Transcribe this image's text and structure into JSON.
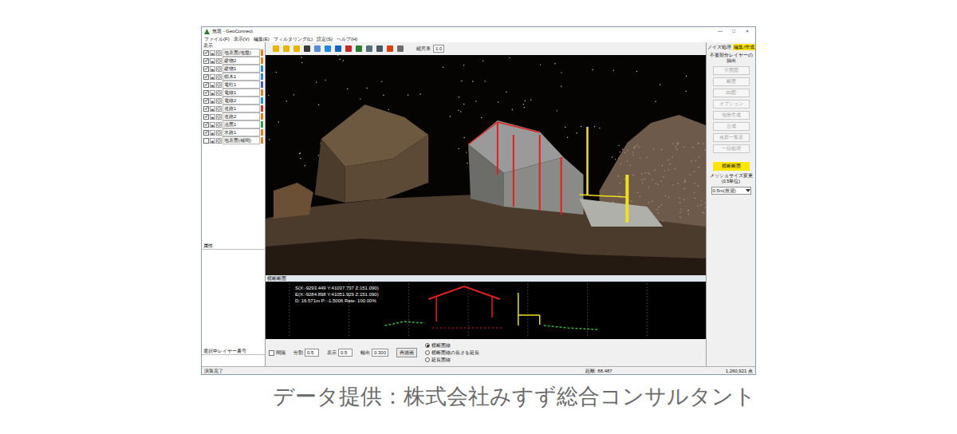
{
  "window": {
    "title": "無題 - GeoConnect",
    "controls": [
      "—",
      "□",
      "×"
    ]
  },
  "menu": [
    "ファイル(F)",
    "表示(V)",
    "編集(E)",
    "フィルタリング(L)",
    "設定(S)",
    "ヘルプ(H)"
  ],
  "layers_title": "表示",
  "layers": [
    {
      "name": "地表面(地盤)",
      "visible": true,
      "color": "#e67e22"
    },
    {
      "name": "建物2",
      "visible": true,
      "color": "#e67e22"
    },
    {
      "name": "建物1",
      "visible": true,
      "color": "#2e86de"
    },
    {
      "name": "樹木1",
      "visible": true,
      "color": "#2e86de"
    },
    {
      "name": "電柱1",
      "visible": true,
      "color": "#3b5bdb"
    },
    {
      "name": "電線1",
      "visible": true,
      "color": "#e67e22"
    },
    {
      "name": "電線2",
      "visible": true,
      "color": "#1e90ff"
    },
    {
      "name": "道路1",
      "visible": true,
      "color": "#e03131"
    },
    {
      "name": "道路2",
      "visible": true,
      "color": "#e67e22"
    },
    {
      "name": "法面1",
      "visible": true,
      "color": "#2f9e44"
    },
    {
      "name": "水路1",
      "visible": true,
      "color": "#e67e22"
    },
    {
      "name": "地表面(補間)",
      "visible": false,
      "color": "#e67e22"
    }
  ],
  "attributes_label": "属性",
  "selected_layer_label": "選択中レイヤー番号",
  "toolbar": {
    "scale_label": "縮尺率",
    "scale_value": "1.0"
  },
  "right_panel": {
    "tabs": [
      {
        "label": "ノイズ処理",
        "selected": false
      },
      {
        "label": "編集/作成",
        "selected": true
      }
    ],
    "subtitle": "不要部分レイヤーの抽出",
    "buttons": [
      {
        "label": "平面図",
        "disabled": true
      },
      {
        "label": "断面",
        "disabled": true
      },
      {
        "label": "3D図",
        "disabled": true
      },
      {
        "label": "オプション",
        "disabled": true
      },
      {
        "label": "地形生成",
        "disabled": true
      },
      {
        "label": "合成",
        "disabled": true
      },
      {
        "label": "点群一覧表",
        "disabled": true
      },
      {
        "label": "一括処理",
        "disabled": true
      }
    ],
    "highlight_button": "横断断面",
    "mesh_label": "メッシュサイズ変更(0.5単位)",
    "mesh_value": "0.5m(推奨)"
  },
  "section": {
    "title": "横断断面",
    "readouts": [
      "S(X:-9293.449 Y:41037.737 Z:151.090)",
      "E(X:-9284.898 Y:41051.929 Z:151.090)",
      "D: 16.571m  P: -1.5006  Rate: 100.00%"
    ]
  },
  "controls": {
    "interval": {
      "label": "間隔",
      "checked": false
    },
    "fields": [
      {
        "label": "分割",
        "value": "0.5"
      },
      {
        "label": "表示",
        "value": "0.5"
      },
      {
        "label": "幅出",
        "value": "0.300"
      }
    ],
    "redraw": "再描画",
    "radios": [
      {
        "label": "横断面線",
        "selected": true
      },
      {
        "label": "横断面線の長さを延長",
        "selected": false
      },
      {
        "label": "延長面線",
        "selected": false
      }
    ]
  },
  "status_bar": [
    "演算完了",
    "距離: 88.487",
    "1,260,921 点"
  ],
  "caption": "データ提供：株式会社みすず総合コンサルタント"
}
